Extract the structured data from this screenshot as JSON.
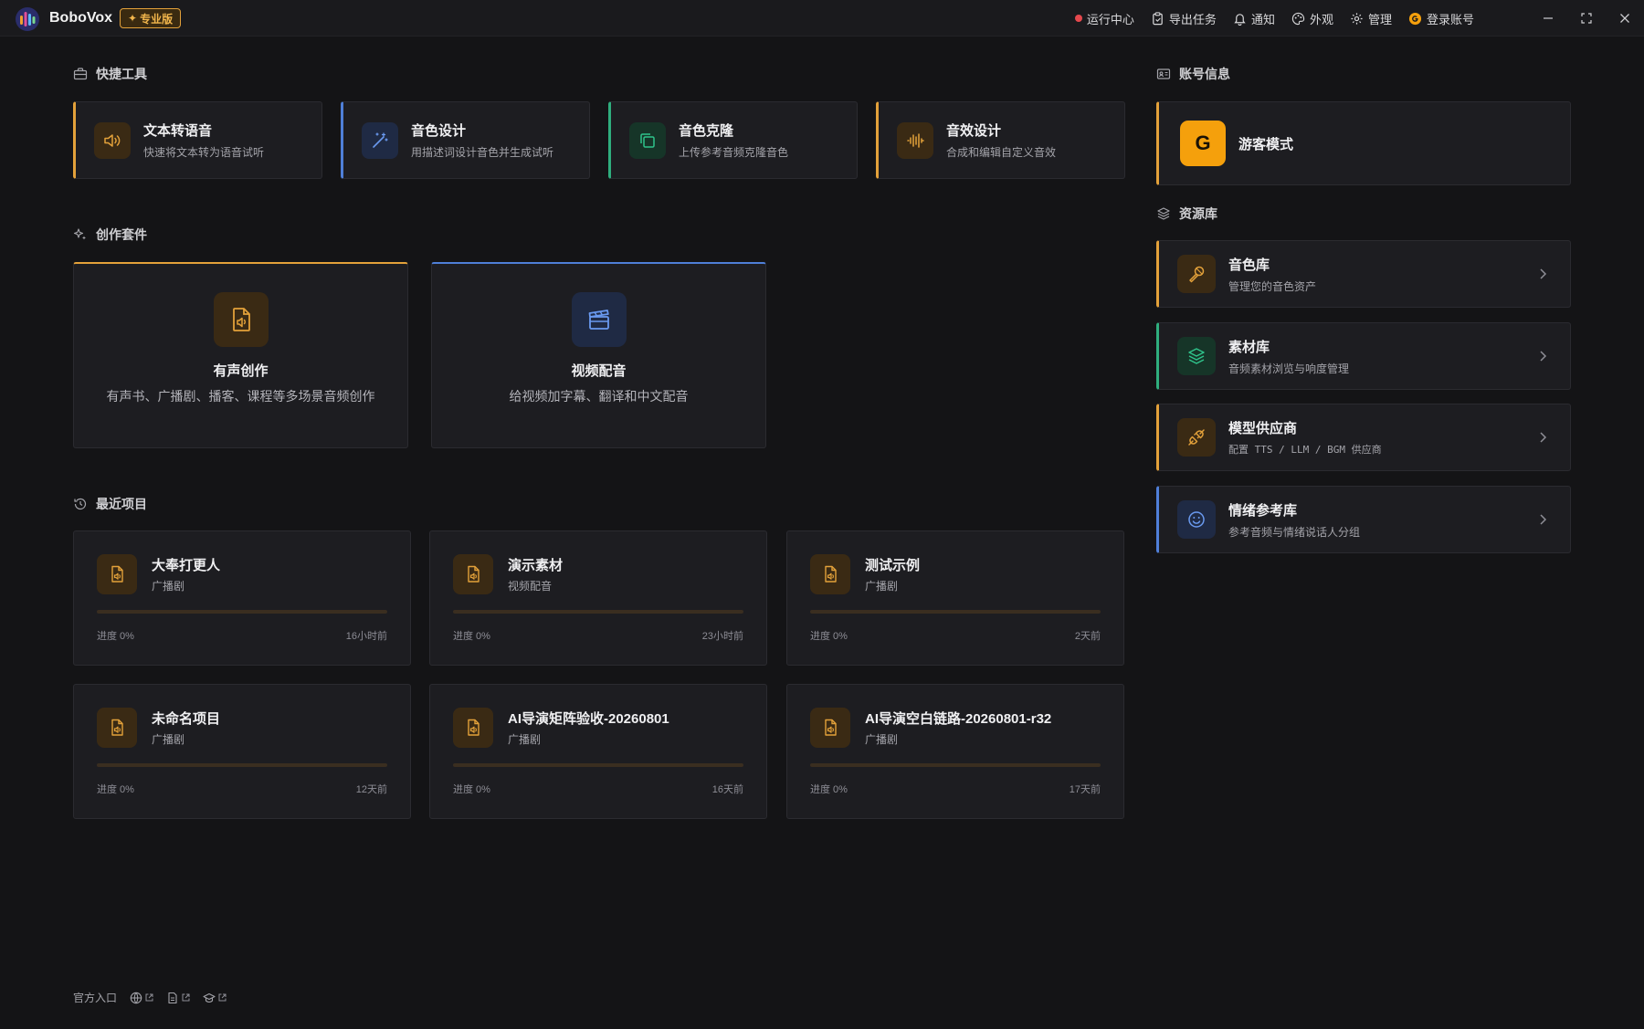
{
  "app": {
    "name": "BoboVox",
    "badge": "专业版"
  },
  "topbar": {
    "actions": [
      {
        "label": "运行中心",
        "icon": "red-dot-icon"
      },
      {
        "label": "导出任务",
        "icon": "clipboard-icon"
      },
      {
        "label": "通知",
        "icon": "bell-icon"
      },
      {
        "label": "外观",
        "icon": "palette-icon"
      },
      {
        "label": "管理",
        "icon": "gear-icon"
      },
      {
        "label": "登录账号",
        "icon": "google-icon"
      }
    ]
  },
  "sections": {
    "quick_tools": "快捷工具",
    "creation_suite": "创作套件",
    "recent_projects": "最近项目",
    "account": "账号信息",
    "resources": "资源库"
  },
  "quick_tools": [
    {
      "title": "文本转语音",
      "desc": "快速将文本转为语音试听",
      "icon": "speaker-icon",
      "accent": "#e3a13a"
    },
    {
      "title": "音色设计",
      "desc": "用描述词设计音色并生成试听",
      "icon": "magic-wand-icon",
      "accent": "#4f7fd8"
    },
    {
      "title": "音色克隆",
      "desc": "上传参考音频克隆音色",
      "icon": "copy-icon",
      "accent": "#2fae7e"
    },
    {
      "title": "音效设计",
      "desc": "合成和编辑自定义音效",
      "icon": "waveform-icon",
      "accent": "#e3a13a"
    }
  ],
  "creation_suite": [
    {
      "title": "有声创作",
      "desc": "有声书、广播剧、播客、课程等多场景音频创作",
      "icon": "audio-file-icon",
      "accent": "#e3a13a"
    },
    {
      "title": "视频配音",
      "desc": "给视频加字幕、翻译和中文配音",
      "icon": "clapperboard-icon",
      "accent": "#4f7fd8"
    }
  ],
  "recent_projects": [
    {
      "name": "大奉打更人",
      "type": "广播剧",
      "progress_label": "进度 0%",
      "progress": 0,
      "time": "16小时前"
    },
    {
      "name": "演示素材",
      "type": "视频配音",
      "progress_label": "进度 0%",
      "progress": 0,
      "time": "23小时前"
    },
    {
      "name": "测试示例",
      "type": "广播剧",
      "progress_label": "进度 0%",
      "progress": 0,
      "time": "2天前"
    },
    {
      "name": "未命名项目",
      "type": "广播剧",
      "progress_label": "进度 0%",
      "progress": 0,
      "time": "12天前"
    },
    {
      "name": "AI导演矩阵验收-20260801",
      "type": "广播剧",
      "progress_label": "进度 0%",
      "progress": 0,
      "time": "16天前"
    },
    {
      "name": "AI导演空白链路-20260801-r32",
      "type": "广播剧",
      "progress_label": "进度 0%",
      "progress": 0,
      "time": "17天前"
    }
  ],
  "account": {
    "avatar_letter": "G",
    "name": "游客模式"
  },
  "resources": [
    {
      "title": "音色库",
      "desc": "管理您的音色资产",
      "icon": "microphone-icon",
      "accent": "#e3a13a"
    },
    {
      "title": "素材库",
      "desc": "音频素材浏览与响度管理",
      "icon": "layers-icon",
      "accent": "#2fae7e"
    },
    {
      "title": "模型供应商",
      "desc": "配置 TTS / LLM / BGM 供应商",
      "icon": "plug-icon",
      "accent": "#e3a13a"
    },
    {
      "title": "情绪参考库",
      "desc": "参考音频与情绪说话人分组",
      "icon": "smile-icon",
      "accent": "#4f7fd8"
    }
  ],
  "footer": {
    "label": "官方入口",
    "links": [
      "globe-icon",
      "document-icon",
      "graduation-cap-icon"
    ]
  }
}
